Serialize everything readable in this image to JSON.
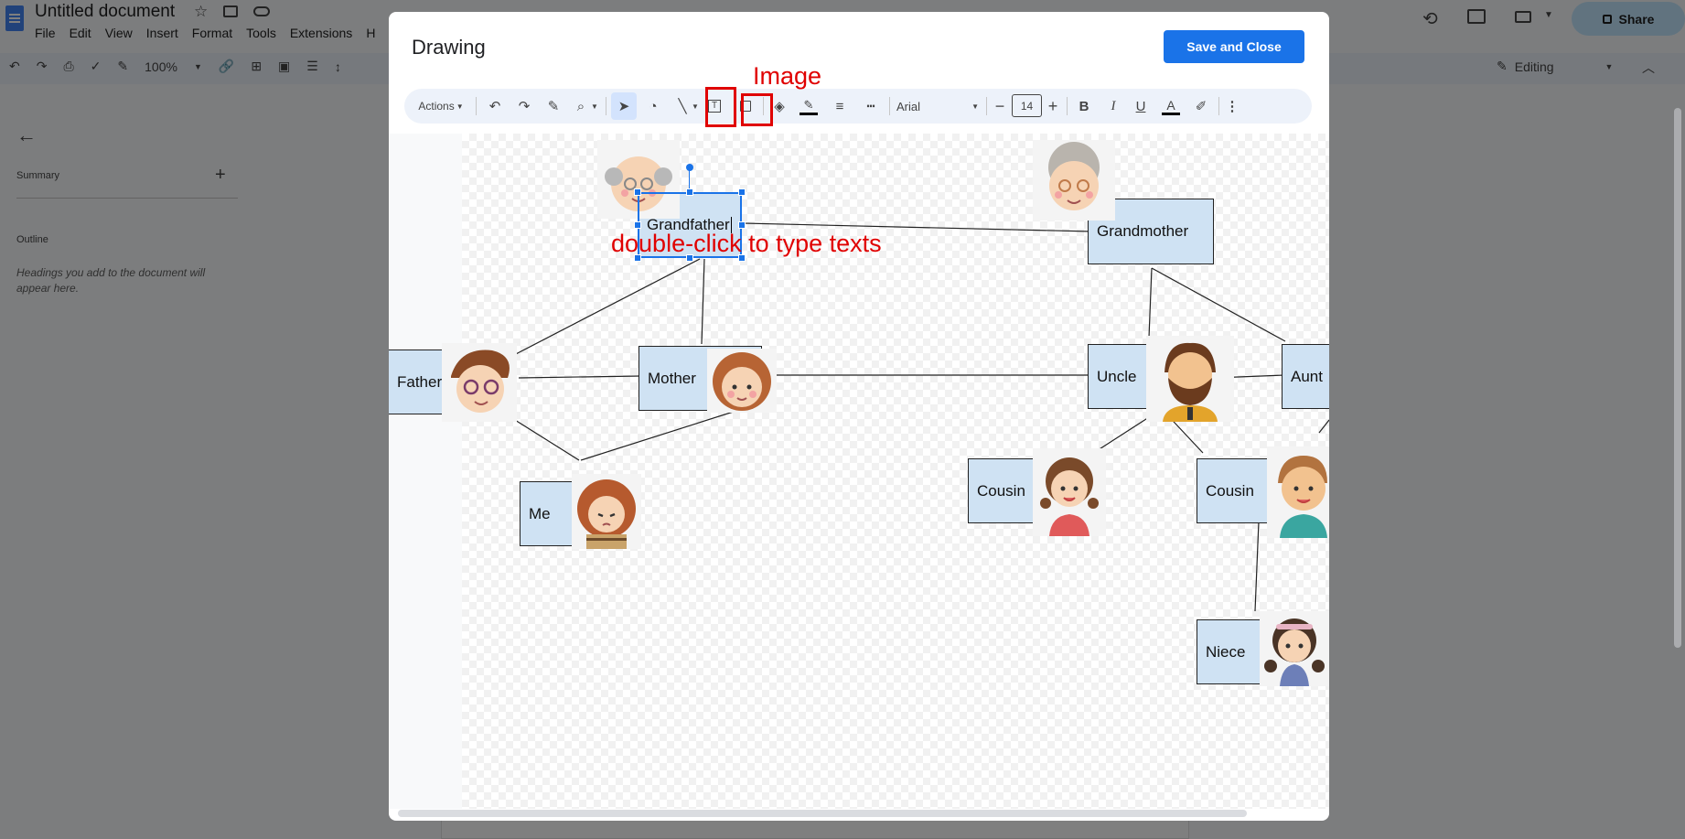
{
  "docs": {
    "title": "Untitled document",
    "menu": [
      "File",
      "Edit",
      "View",
      "Insert",
      "Format",
      "Tools",
      "Extensions",
      "H"
    ],
    "zoom": "100%",
    "share_label": "Share",
    "mode_label": "Editing",
    "sidebar": {
      "summary_label": "Summary",
      "outline_label": "Outline",
      "outline_hint": "Headings you add to the document will appear here."
    }
  },
  "dialog": {
    "title": "Drawing",
    "save_label": "Save and Close",
    "toolbar": {
      "actions_label": "Actions",
      "font_name": "Arial",
      "font_size": "14"
    }
  },
  "diagram": {
    "nodes": {
      "grandfather": "Grandfather",
      "grandmother": "Grandmother",
      "father": "Father",
      "mother": "Mother",
      "me": "Me",
      "uncle": "Uncle",
      "aunt": "Aunt",
      "cousin1": "Cousin",
      "cousin2": "Cousin",
      "niece": "Niece"
    }
  },
  "annotations": {
    "image_label": "Image",
    "double_click_hint": "double-click to type texts"
  },
  "colors": {
    "node_fill": "#cfe2f3",
    "annotation_red": "#e00000",
    "primary_blue": "#1a73e8"
  }
}
